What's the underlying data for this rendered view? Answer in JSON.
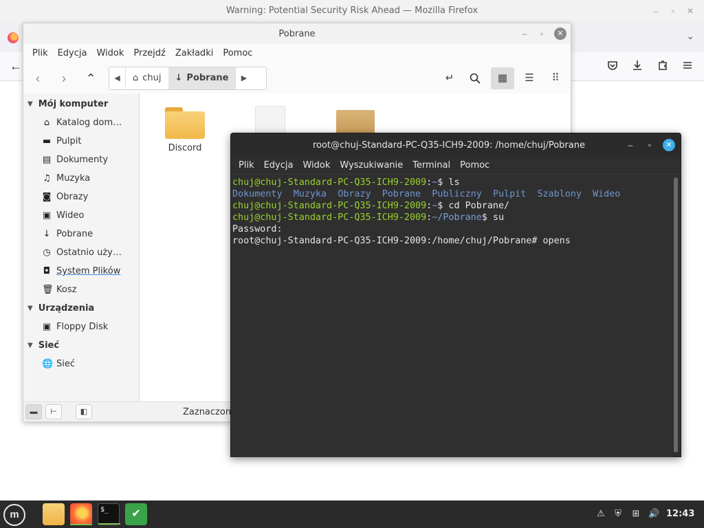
{
  "firefox": {
    "title": "Warning: Potential Security Risk Ahead — Mozilla Firefox"
  },
  "nemo": {
    "title": "Pobrane",
    "menu": [
      "Plik",
      "Edycja",
      "Widok",
      "Przejdź",
      "Zakładki",
      "Pomoc"
    ],
    "path": [
      "chuj",
      "Pobrane"
    ],
    "sidebar": {
      "sections": [
        {
          "label": "Mój komputer",
          "items": [
            {
              "label": "Katalog dom…",
              "icon": "home-icon"
            },
            {
              "label": "Pulpit",
              "icon": "desktop-icon"
            },
            {
              "label": "Dokumenty",
              "icon": "documents-icon"
            },
            {
              "label": "Muzyka",
              "icon": "music-icon"
            },
            {
              "label": "Obrazy",
              "icon": "camera-icon"
            },
            {
              "label": "Wideo",
              "icon": "video-icon"
            },
            {
              "label": "Pobrane",
              "icon": "download-icon"
            },
            {
              "label": "Ostatnio uży…",
              "icon": "recent-icon"
            },
            {
              "label": "System Plików",
              "icon": "drive-icon"
            },
            {
              "label": "Kosz",
              "icon": "trash-icon"
            }
          ]
        },
        {
          "label": "Urządzenia",
          "items": [
            {
              "label": "Floppy Disk",
              "icon": "floppy-icon"
            }
          ]
        },
        {
          "label": "Sieć",
          "items": [
            {
              "label": "Sieć",
              "icon": "network-icon"
            }
          ]
        }
      ]
    },
    "files": [
      {
        "label": "Discord",
        "type": "folder"
      },
      {
        "label": "",
        "type": "document"
      },
      {
        "label": "",
        "type": "package"
      }
    ],
    "status": "Zaznaczono"
  },
  "terminal": {
    "title": "root@chuj-Standard-PC-Q35-ICH9-2009: /home/chuj/Pobrane",
    "menu": [
      "Plik",
      "Edycja",
      "Widok",
      "Wyszukiwanie",
      "Terminal",
      "Pomoc"
    ],
    "user_host": "chuj@chuj-Standard-PC-Q35-ICH9-2009",
    "line1_cmd": "ls",
    "ls_output": [
      "Dokumenty",
      "Muzyka",
      "Obrazy",
      "Pobrane",
      "Publiczny",
      "Pulpit",
      "Szablony",
      "Wideo"
    ],
    "line3_cmd": "cd Pobrane/",
    "line4_path": "~/Pobrane",
    "line4_cmd": "su",
    "password_prompt": "Password:",
    "root_prompt": "root@chuj-Standard-PC-Q35-ICH9-2009:/home/chuj/Pobrane#",
    "root_cmd": "opens"
  },
  "taskbar": {
    "clock": "12:43"
  },
  "colors": {
    "prompt_green": "#9ad22d",
    "path_blue": "#7b9fd9",
    "terminal_bg": "#2f2f2f",
    "close_blue": "#3daee9"
  }
}
